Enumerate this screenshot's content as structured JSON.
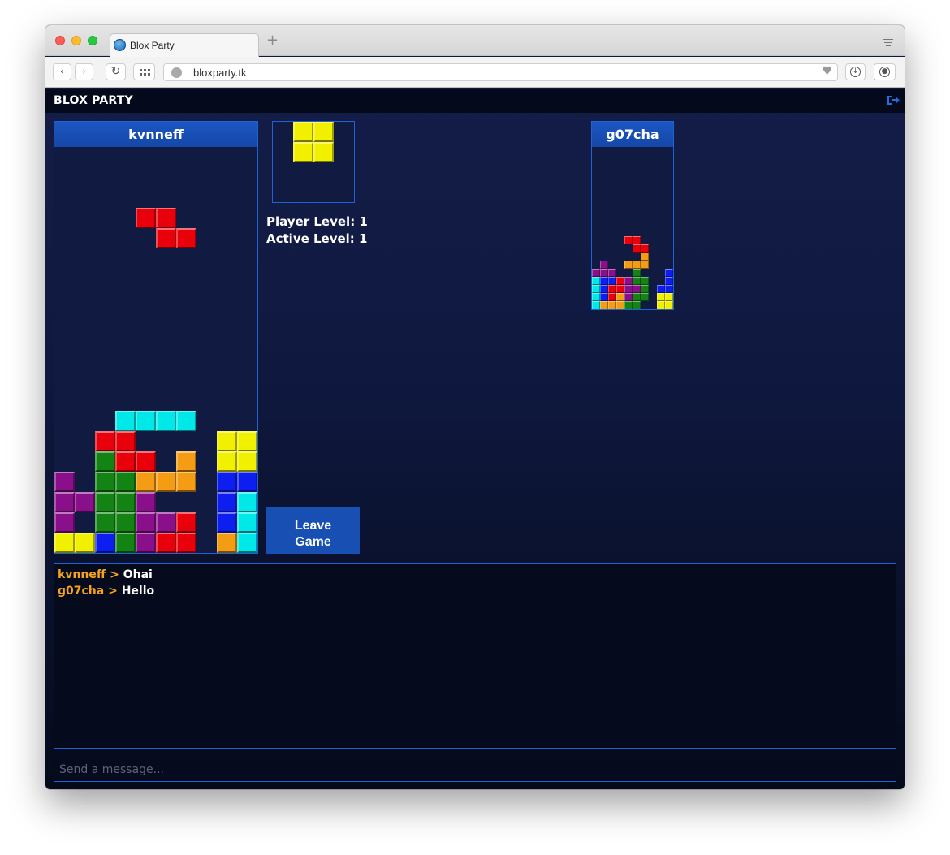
{
  "browser": {
    "tab_title": "Blox Party",
    "url": "bloxparty.tk",
    "new_tab_label": "+"
  },
  "app": {
    "title": "BLOX PARTY"
  },
  "colors": {
    "red": "#e8000b",
    "green": "#138313",
    "cyan": "#00e8e8",
    "yellow": "#f0f000",
    "orange": "#f49c14",
    "purple": "#8a0f8a",
    "blue": "#0c1ff0"
  },
  "player_board": {
    "player_name": "kvnneff",
    "cols": 10,
    "rows": 20,
    "active_piece": {
      "color": "red",
      "cells": [
        [
          4,
          4
        ],
        [
          5,
          4
        ],
        [
          5,
          5
        ],
        [
          6,
          5
        ]
      ]
    },
    "cells": [
      [
        3,
        14,
        "cyan"
      ],
      [
        4,
        14,
        "cyan"
      ],
      [
        5,
        14,
        "cyan"
      ],
      [
        6,
        14,
        "cyan"
      ],
      [
        2,
        15,
        "red"
      ],
      [
        3,
        15,
        "red"
      ],
      [
        8,
        15,
        "yellow"
      ],
      [
        9,
        15,
        "yellow"
      ],
      [
        2,
        16,
        "green"
      ],
      [
        3,
        16,
        "red"
      ],
      [
        4,
        16,
        "red"
      ],
      [
        6,
        16,
        "orange"
      ],
      [
        8,
        16,
        "yellow"
      ],
      [
        9,
        16,
        "yellow"
      ],
      [
        0,
        17,
        "purple"
      ],
      [
        2,
        17,
        "green"
      ],
      [
        3,
        17,
        "green"
      ],
      [
        4,
        17,
        "orange"
      ],
      [
        5,
        17,
        "orange"
      ],
      [
        6,
        17,
        "orange"
      ],
      [
        8,
        17,
        "blue"
      ],
      [
        9,
        17,
        "blue"
      ],
      [
        0,
        18,
        "purple"
      ],
      [
        1,
        18,
        "purple"
      ],
      [
        2,
        18,
        "green"
      ],
      [
        3,
        18,
        "green"
      ],
      [
        4,
        18,
        "purple"
      ],
      [
        8,
        18,
        "blue"
      ],
      [
        9,
        18,
        "cyan"
      ],
      [
        0,
        19,
        "purple"
      ],
      [
        2,
        19,
        "green"
      ],
      [
        3,
        19,
        "green"
      ],
      [
        4,
        19,
        "purple"
      ],
      [
        5,
        19,
        "purple"
      ],
      [
        6,
        19,
        "red"
      ],
      [
        8,
        19,
        "blue"
      ],
      [
        9,
        19,
        "cyan"
      ],
      [
        0,
        20,
        "yellow"
      ],
      [
        1,
        20,
        "yellow"
      ],
      [
        2,
        20,
        "blue"
      ],
      [
        3,
        20,
        "green"
      ],
      [
        4,
        20,
        "purple"
      ],
      [
        5,
        20,
        "red"
      ],
      [
        6,
        20,
        "red"
      ],
      [
        8,
        20,
        "orange"
      ],
      [
        9,
        20,
        "cyan"
      ]
    ]
  },
  "next_piece": {
    "color": "yellow",
    "cells": [
      [
        1,
        0
      ],
      [
        2,
        0
      ],
      [
        1,
        1
      ],
      [
        2,
        1
      ]
    ]
  },
  "levels": {
    "player_level": "Player Level: 1",
    "active_level": "Active Level: 1"
  },
  "leave_button": {
    "line1": "Leave",
    "line2": "Game"
  },
  "opponent_board": {
    "player_name": "g07cha",
    "cols": 10,
    "rows": 20,
    "cells": [
      [
        4,
        11,
        "red"
      ],
      [
        5,
        11,
        "red"
      ],
      [
        5,
        12,
        "red"
      ],
      [
        6,
        12,
        "red"
      ],
      [
        6,
        13,
        "orange"
      ],
      [
        1,
        14,
        "purple"
      ],
      [
        4,
        14,
        "orange"
      ],
      [
        5,
        14,
        "orange"
      ],
      [
        6,
        14,
        "orange"
      ],
      [
        0,
        15,
        "purple"
      ],
      [
        1,
        15,
        "purple"
      ],
      [
        2,
        15,
        "purple"
      ],
      [
        5,
        15,
        "green"
      ],
      [
        9,
        15,
        "blue"
      ],
      [
        0,
        16,
        "cyan"
      ],
      [
        1,
        16,
        "blue"
      ],
      [
        2,
        16,
        "blue"
      ],
      [
        3,
        16,
        "red"
      ],
      [
        4,
        16,
        "purple"
      ],
      [
        5,
        16,
        "green"
      ],
      [
        6,
        16,
        "green"
      ],
      [
        9,
        16,
        "blue"
      ],
      [
        0,
        17,
        "cyan"
      ],
      [
        1,
        17,
        "blue"
      ],
      [
        2,
        17,
        "red"
      ],
      [
        3,
        17,
        "red"
      ],
      [
        4,
        17,
        "purple"
      ],
      [
        5,
        17,
        "purple"
      ],
      [
        6,
        17,
        "green"
      ],
      [
        8,
        17,
        "blue"
      ],
      [
        9,
        17,
        "blue"
      ],
      [
        0,
        18,
        "cyan"
      ],
      [
        1,
        18,
        "blue"
      ],
      [
        2,
        18,
        "red"
      ],
      [
        3,
        18,
        "orange"
      ],
      [
        4,
        18,
        "purple"
      ],
      [
        5,
        18,
        "green"
      ],
      [
        6,
        18,
        "green"
      ],
      [
        8,
        18,
        "yellow"
      ],
      [
        9,
        18,
        "yellow"
      ],
      [
        0,
        19,
        "cyan"
      ],
      [
        1,
        19,
        "orange"
      ],
      [
        2,
        19,
        "orange"
      ],
      [
        3,
        19,
        "orange"
      ],
      [
        4,
        19,
        "green"
      ],
      [
        5,
        19,
        "green"
      ],
      [
        8,
        19,
        "yellow"
      ],
      [
        9,
        19,
        "yellow"
      ]
    ]
  },
  "chat": {
    "separator": " > ",
    "messages": [
      {
        "user": "kvnneff",
        "text": "Ohai"
      },
      {
        "user": "g07cha",
        "text": "Hello"
      }
    ],
    "input_placeholder": "Send a message..."
  }
}
